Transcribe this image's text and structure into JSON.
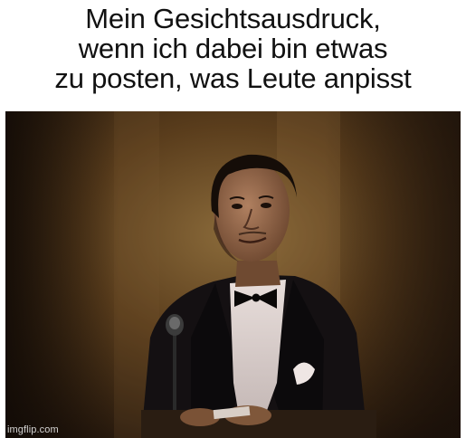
{
  "caption": {
    "lines": [
      "Mein Gesichtsausdruck,",
      "wenn ich dabei bin etwas",
      "zu posten, was Leute anpisst"
    ]
  },
  "watermark": "imgflip.com",
  "colors": {
    "background": "#ffffff",
    "caption_text": "#111111",
    "photo_bg_warm": "#6b4a22",
    "photo_bg_dark": "#1e130a"
  }
}
